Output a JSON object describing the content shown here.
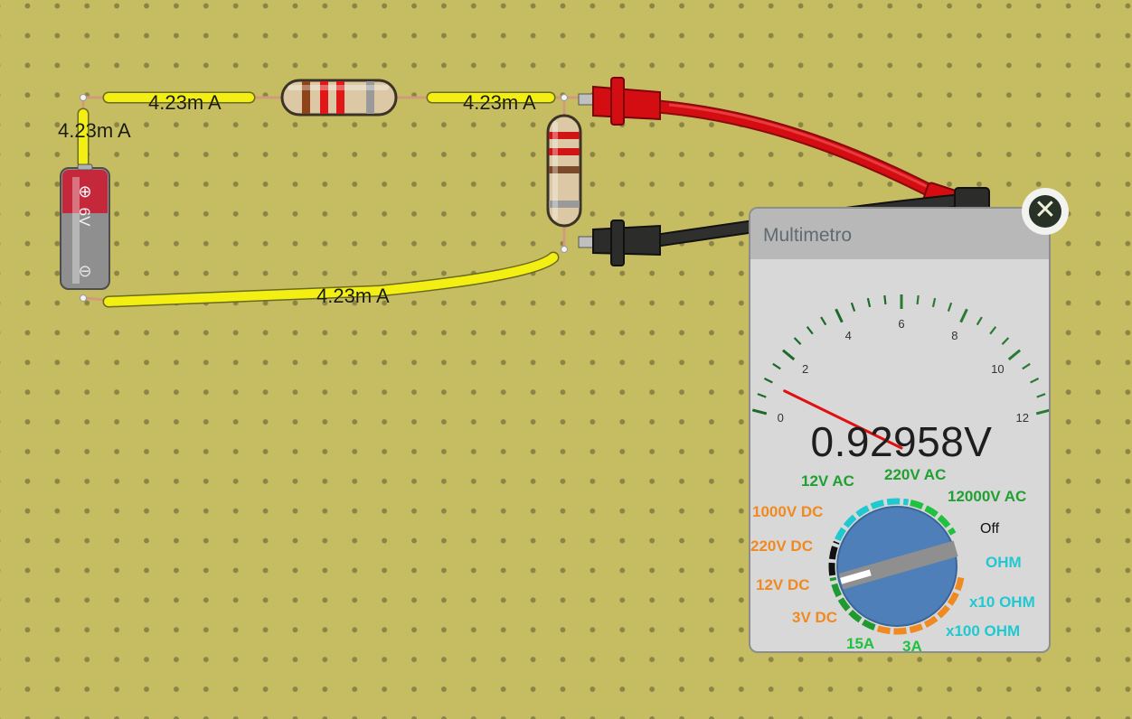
{
  "circuit": {
    "wire_current_labels": [
      "4.23m A",
      "4.23m A",
      "4.23m A",
      "4.23m A"
    ],
    "battery": {
      "voltage_label": "6V",
      "positive_symbol": "⊕",
      "negative_symbol": "⊖"
    },
    "colors": {
      "wire": "#f2ee10",
      "board": "#c6bd62",
      "red_probe": "#d40d12",
      "black_probe": "#2c2c2a"
    }
  },
  "multimeter": {
    "title": "Multimetro",
    "reading": "0.92958V",
    "scale_labels": [
      "0",
      "2",
      "4",
      "6",
      "8",
      "10",
      "12"
    ],
    "needle_value": 0.93,
    "scale_max": 12,
    "selected_range": "12V DC",
    "ranges": [
      {
        "label": "12V AC",
        "color": "#20a030"
      },
      {
        "label": "220V AC",
        "color": "#20a030"
      },
      {
        "label": "12000V AC",
        "color": "#20a030"
      },
      {
        "label": "Off",
        "color": "#111111"
      },
      {
        "label": "OHM",
        "color": "#20c8d0"
      },
      {
        "label": "x10 OHM",
        "color": "#20c8d0"
      },
      {
        "label": "x100 OHM",
        "color": "#20c8d0"
      },
      {
        "label": "3A",
        "color": "#20c040"
      },
      {
        "label": "15A",
        "color": "#20c040"
      },
      {
        "label": "3V DC",
        "color": "#f08a20"
      },
      {
        "label": "12V DC",
        "color": "#f08a20"
      },
      {
        "label": "220V DC",
        "color": "#f08a20"
      },
      {
        "label": "1000V DC",
        "color": "#f08a20"
      }
    ],
    "close_icon": "close-icon"
  }
}
